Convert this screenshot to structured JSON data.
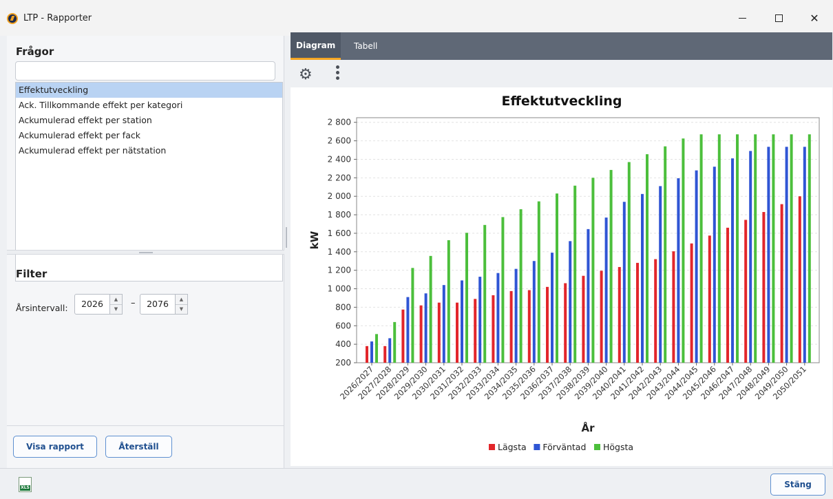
{
  "window": {
    "title": "LTP - Rapporter"
  },
  "left": {
    "queries_title": "Frågor",
    "search_value": "",
    "queries": [
      "Effektutveckling",
      "Ack. Tillkommande effekt per kategori",
      "Ackumulerad effekt per station",
      "Ackumulerad effekt per fack",
      "Ackumulerad effekt per nätstation"
    ],
    "selected_index": 0,
    "filter_title": "Filter",
    "year_range_label": "Årsintervall:",
    "year_from": "2026",
    "year_to": "2076",
    "range_dash": "–",
    "show_report_label": "Visa rapport",
    "reset_label": "Återställ"
  },
  "right": {
    "tabs": [
      "Diagram",
      "Tabell"
    ],
    "active_tab": 0
  },
  "footer": {
    "close_label": "Stäng",
    "excel_icon": "xls-icon",
    "excel_text": "XLS"
  },
  "colors": {
    "lagsta": "#e2262b",
    "forvantad": "#2f55d4",
    "hogsta": "#4cbf3c"
  },
  "chart_data": {
    "type": "bar",
    "title": "Effektutveckling",
    "xlabel": "År",
    "ylabel": "kW",
    "ylim": [
      200,
      2850
    ],
    "yticks": [
      200,
      400,
      600,
      800,
      1000,
      1200,
      1400,
      1600,
      1800,
      2000,
      2200,
      2400,
      2600,
      2800
    ],
    "ytick_labels": [
      "200",
      "400",
      "600",
      "800",
      "1 000",
      "1 200",
      "1 400",
      "1 600",
      "1 800",
      "2 000",
      "2 200",
      "2 400",
      "2 600",
      "2 800"
    ],
    "grid": true,
    "legend_position": "bottom",
    "categories": [
      "2026/2027",
      "2027/2028",
      "2028/2029",
      "2029/2030",
      "2030/2031",
      "2031/2032",
      "2032/2033",
      "2033/2034",
      "2034/2035",
      "2035/2036",
      "2036/2037",
      "2037/2038",
      "2038/2039",
      "2039/2040",
      "2040/2041",
      "2041/2042",
      "2042/2043",
      "2043/2044",
      "2044/2045",
      "2045/2046",
      "2046/2047",
      "2047/2048",
      "2048/2049",
      "2049/2050",
      "2050/2051"
    ],
    "series": [
      {
        "name": "Lägsta",
        "color": "#e2262b",
        "values": [
          380,
          380,
          775,
          820,
          850,
          850,
          890,
          930,
          975,
          985,
          1020,
          1060,
          1140,
          1195,
          1235,
          1280,
          1320,
          1405,
          1490,
          1575,
          1660,
          1745,
          1830,
          1915,
          2000
        ]
      },
      {
        "name": "Förväntad",
        "color": "#2f55d4",
        "values": [
          430,
          465,
          910,
          950,
          1040,
          1090,
          1130,
          1170,
          1215,
          1300,
          1390,
          1515,
          1645,
          1770,
          1940,
          2025,
          2110,
          2195,
          2280,
          2320,
          2410,
          2490,
          2535,
          2535,
          2535
        ]
      },
      {
        "name": "Högsta",
        "color": "#4cbf3c",
        "values": [
          510,
          640,
          1225,
          1355,
          1525,
          1605,
          1690,
          1775,
          1860,
          1945,
          2030,
          2115,
          2200,
          2285,
          2370,
          2455,
          2540,
          2625,
          2670,
          2670,
          2670,
          2670,
          2670,
          2670,
          2670
        ]
      }
    ]
  }
}
